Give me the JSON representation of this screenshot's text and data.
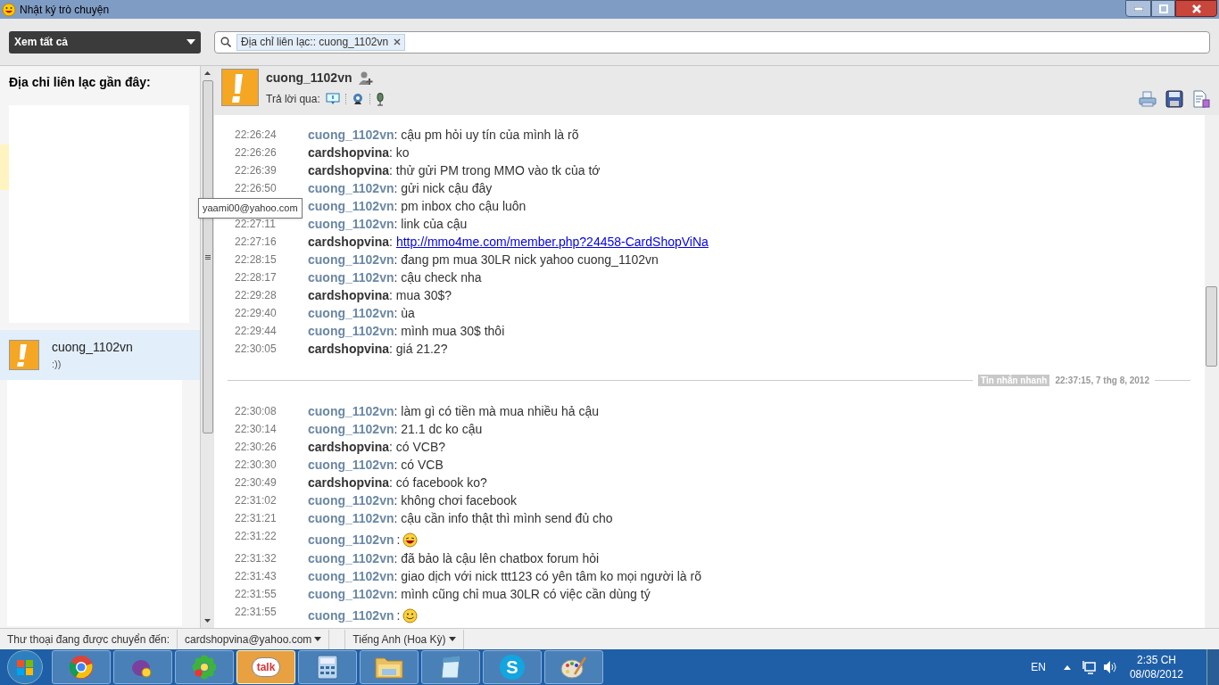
{
  "window": {
    "title": "Nhật ký trò chuyện"
  },
  "toolbar": {
    "filter": "Xem tất cả",
    "search_tag": "Địa chỉ liên lạc:: cuong_1102vn"
  },
  "sidebar": {
    "heading": "Địa chỉ liên lạc gần đây:",
    "tooltip": "yaami00@yahoo.com",
    "contacts": [
      {
        "name": "cuong_1102vn",
        "status": ":))",
        "selected": true,
        "color": "#f5a623"
      }
    ]
  },
  "chat": {
    "contact": "cuong_1102vn",
    "reply_label": "Trả lời qua:",
    "messages": [
      {
        "time": "22:26:24",
        "sender": "cuong_1102vn",
        "self": false,
        "text": ": cậu pm hỏi uy tín của mình là rõ"
      },
      {
        "time": "22:26:26",
        "sender": "cardshopvina",
        "self": true,
        "text": ": ko"
      },
      {
        "time": "22:26:39",
        "sender": "cardshopvina",
        "self": true,
        "text": ": thử gửi PM trong MMO vào tk của tớ"
      },
      {
        "time": "22:26:50",
        "sender": "cuong_1102vn",
        "self": false,
        "text": ": gửi nick cậu đây"
      },
      {
        "sender": "cuong_1102vn",
        "self": false,
        "text": ": pm inbox cho cậu luôn"
      },
      {
        "time": "22:27:11",
        "sender": "cuong_1102vn",
        "self": false,
        "text": ": link của cậu"
      },
      {
        "time": "22:27:16",
        "sender": "cardshopvina",
        "self": true,
        "text": ":",
        "link": "http://mmo4me.com/member.php?24458-CardShopViNa",
        "kind": "link"
      },
      {
        "time": "22:28:15",
        "sender": "cuong_1102vn",
        "self": false,
        "text": ": đang pm mua 30LR nick yahoo cuong_1102vn"
      },
      {
        "time": "22:28:17",
        "sender": "cuong_1102vn",
        "self": false,
        "text": ": cậu check nha"
      },
      {
        "time": "22:29:28",
        "sender": "cardshopvina",
        "self": true,
        "text": ": mua 30$?"
      },
      {
        "time": "22:29:40",
        "sender": "cuong_1102vn",
        "self": false,
        "text": ": ùa"
      },
      {
        "time": "22:29:44",
        "sender": "cuong_1102vn",
        "self": false,
        "text": ": mình mua 30$ thôi"
      },
      {
        "time": "22:30:05",
        "sender": "cardshopvina",
        "self": true,
        "text": ": giá 21.2?"
      },
      {
        "kind": "divider",
        "label": "Tin nhắn nhanh",
        "time": "22:37:15, 7 thg 8, 2012"
      },
      {
        "time": "22:30:08",
        "sender": "cuong_1102vn",
        "self": false,
        "text": ": làm gì có tiền mà mua nhiều hả cậu"
      },
      {
        "time": "22:30:14",
        "sender": "cuong_1102vn",
        "self": false,
        "text": ": 21.1 dc ko cậu"
      },
      {
        "time": "22:30:26",
        "sender": "cardshopvina",
        "self": true,
        "text": ": có VCB?"
      },
      {
        "time": "22:30:30",
        "sender": "cuong_1102vn",
        "self": false,
        "text": ": có VCB"
      },
      {
        "time": "22:30:49",
        "sender": "cardshopvina",
        "self": true,
        "text": ": có facebook ko?"
      },
      {
        "time": "22:31:02",
        "sender": "cuong_1102vn",
        "self": false,
        "text": ": không chơi facebook"
      },
      {
        "time": "22:31:21",
        "sender": "cuong_1102vn",
        "self": false,
        "text": ": cậu cần info thật thì mình send đủ cho"
      },
      {
        "time": "22:31:22",
        "sender": "cuong_1102vn",
        "self": false,
        "text": ":",
        "kind": "emoji"
      },
      {
        "time": "22:31:32",
        "sender": "cuong_1102vn",
        "self": false,
        "text": ": đã bảo là cậu lên chatbox forum hỏi"
      },
      {
        "time": "22:31:43",
        "sender": "cuong_1102vn",
        "self": false,
        "text": ": giao dịch với nick ttt123 có yên tâm ko mọi người là rõ"
      },
      {
        "time": "22:31:55",
        "sender": "cuong_1102vn",
        "self": false,
        "text": ": mình cũng chỉ mua 30LR có việc cần dùng tý"
      },
      {
        "time": "22:31:55",
        "sender": "cuong_1102vn",
        "self": false,
        "text": ":",
        "kind": "emoji"
      }
    ]
  },
  "status_bar": {
    "label": "Thư thoại đang được chuyển đến:",
    "voicemail": "cardshopvina@yahoo.com",
    "language": "Tiếng Anh (Hoa Kỳ)"
  },
  "taskbar": {
    "apps": [
      {
        "kind": "browser",
        "active": false
      },
      {
        "kind": "messenger",
        "active": false
      },
      {
        "kind": "flower",
        "active": false
      },
      {
        "kind": "talk",
        "label": "talk",
        "active": true
      },
      {
        "kind": "calculator",
        "active": false
      },
      {
        "kind": "folder",
        "active": false
      },
      {
        "kind": "notepad",
        "active": false
      },
      {
        "kind": "skype",
        "label": "S",
        "active": false
      },
      {
        "kind": "paint",
        "active": false
      }
    ],
    "language": "EN",
    "time": "2:35 CH",
    "date": "08/08/2012"
  }
}
